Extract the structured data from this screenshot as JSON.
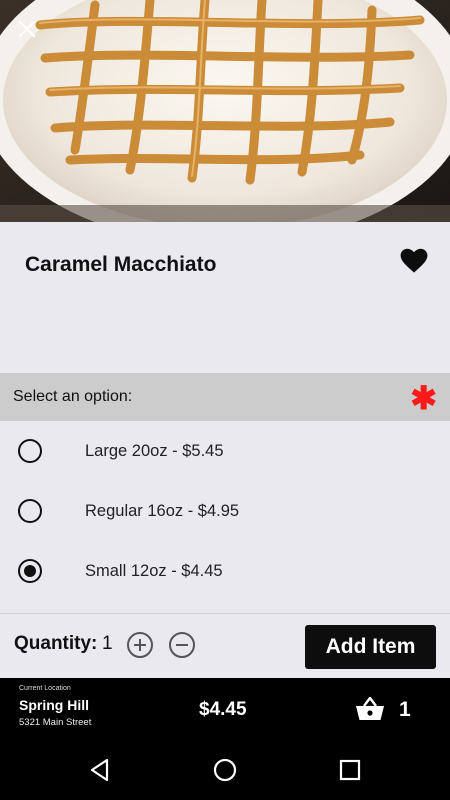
{
  "product": {
    "image_alt": "caramel-macchiato-photo",
    "title": "Caramel Macchiato",
    "close_icon": "close-icon",
    "favorite_icon": "heart-icon"
  },
  "options": {
    "header": "Select an option:",
    "required_mark": "✱",
    "items": [
      {
        "label": "Large 20oz - $5.45",
        "selected": false
      },
      {
        "label": "Regular 16oz - $4.95",
        "selected": false
      },
      {
        "label": "Small 12oz - $4.45",
        "selected": true
      }
    ]
  },
  "quantity": {
    "label": "Quantity:",
    "value": "1",
    "add_label": "Add Item"
  },
  "order_bar": {
    "location_caption": "Current Location",
    "location_name": "Spring Hill",
    "location_address": "5321 Main Street",
    "total": "$4.45",
    "cart_count": "1"
  },
  "colors": {
    "accent_required": "#ff1a1a",
    "primary_button": "#0d0d0d",
    "background": "#e9e9ef",
    "option_header": "#cccccc"
  }
}
